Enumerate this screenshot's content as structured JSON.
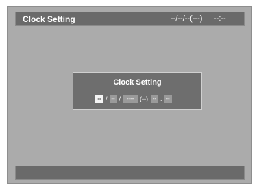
{
  "header": {
    "title": "Clock Setting",
    "date": "--/--/--(---)",
    "time": "--:--"
  },
  "dialog": {
    "title": "Clock Setting",
    "fields": {
      "month": "--",
      "sep1": "/",
      "day": "--",
      "sep2": "/",
      "year": "----",
      "weekday": "(--)",
      "hour": "--",
      "colon": ":",
      "minute": "--"
    }
  }
}
